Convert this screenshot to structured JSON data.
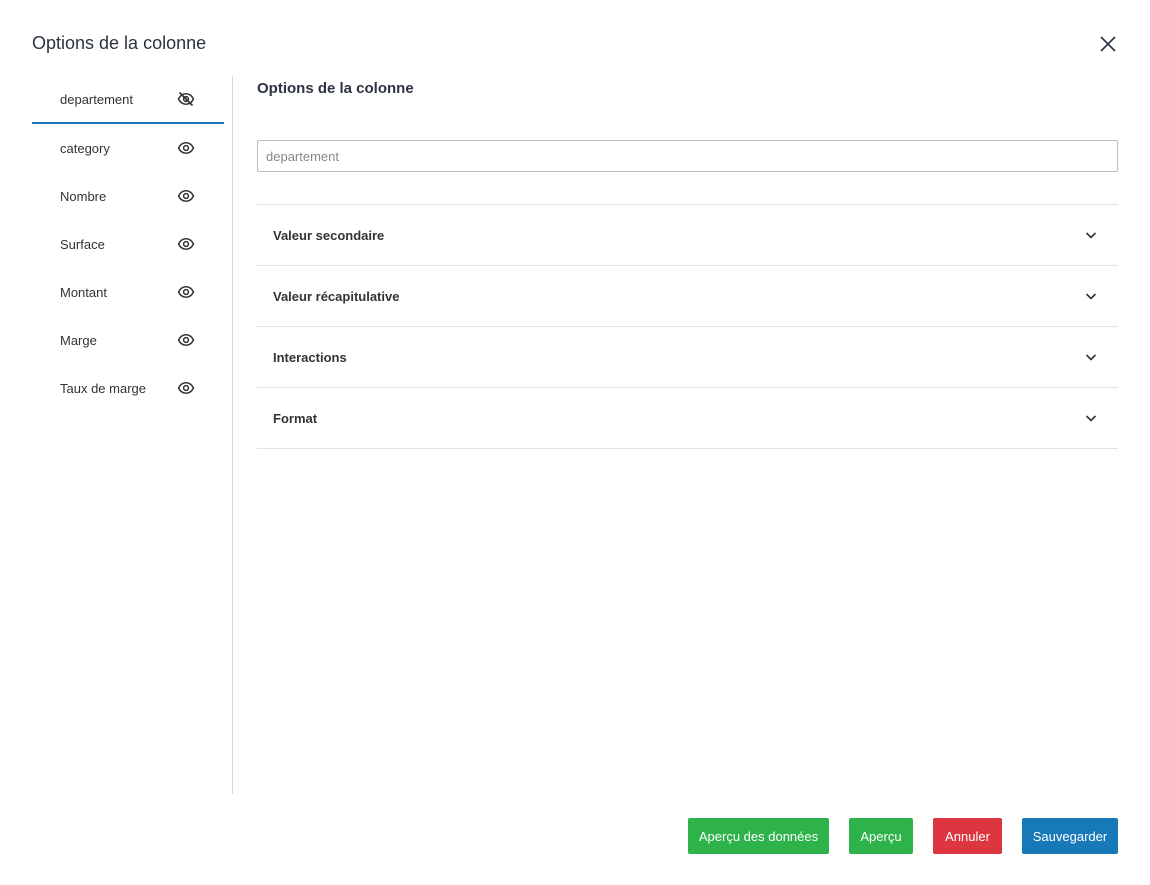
{
  "dialog": {
    "title": "Options de la colonne",
    "close_icon": "close-icon"
  },
  "sidebar": {
    "items": [
      {
        "label": "departement",
        "visible": false,
        "icon": "eye-off-icon",
        "active": true
      },
      {
        "label": "category",
        "visible": true,
        "icon": "eye-icon"
      },
      {
        "label": "Nombre",
        "visible": true,
        "icon": "eye-icon"
      },
      {
        "label": "Surface",
        "visible": true,
        "icon": "eye-icon"
      },
      {
        "label": "Montant",
        "visible": true,
        "icon": "eye-icon"
      },
      {
        "label": "Marge",
        "visible": true,
        "icon": "eye-icon"
      },
      {
        "label": "Taux de marge",
        "visible": true,
        "icon": "eye-icon"
      }
    ]
  },
  "main": {
    "title": "Options de la colonne",
    "name_input": {
      "value": "",
      "placeholder": "departement"
    },
    "sections": [
      {
        "label": "Valeur secondaire"
      },
      {
        "label": "Valeur récapitulative"
      },
      {
        "label": "Interactions"
      },
      {
        "label": "Format"
      }
    ]
  },
  "footer": {
    "data_preview_label": "Aperçu des données",
    "preview_label": "Aperçu",
    "cancel_label": "Annuler",
    "save_label": "Sauvegarder"
  },
  "colors": {
    "accent": "#1779b8",
    "green": "#2db34a",
    "red": "#dc3640"
  }
}
